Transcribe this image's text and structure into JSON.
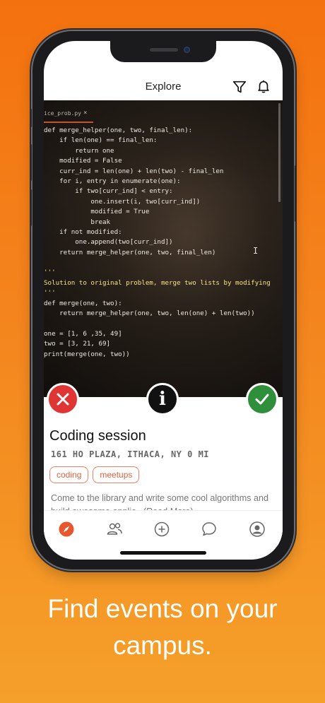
{
  "header": {
    "title": "Explore"
  },
  "editor": {
    "tab_name": "ice_prob.py",
    "tab_close": "×",
    "cursor_glyph": "I",
    "lines": [
      "def merge_helper(one, two, final_len):",
      "    if len(one) == final_len:",
      "        return one",
      "    modified = False",
      "    curr_ind = len(one) + len(two) - final_len",
      "    for i, entry in enumerate(one):",
      "        if two[curr_ind] < entry:",
      "            one.insert(i, two[curr_ind])",
      "            modified = True",
      "            break",
      "    if not modified:",
      "        one.append(two[curr_ind])",
      "    return merge_helper(one, two, final_len)",
      "",
      "'''",
      "Solution to original problem, merge two lists by modifying",
      "'''",
      "def merge(one, two):",
      "    return merge_helper(one, two, len(one) + len(two))",
      "",
      "one = [1, 6 ,35, 49]",
      "two = [3, 21, 69]",
      "print(merge(one, two))"
    ]
  },
  "actions": {
    "reject_icon": "x-icon",
    "info_label": "i",
    "accept_icon": "check-icon"
  },
  "event": {
    "title": "Coding session",
    "location": "161 HO PLAZA, ITHACA, NY   0 MI",
    "tags": [
      "coding",
      "meetups"
    ],
    "description": "Come to the library and write some cool algorithms and build awesome applic...(Read More)"
  },
  "nav": {
    "active": "explore",
    "items": [
      "explore",
      "friends",
      "add",
      "chat",
      "profile"
    ]
  },
  "caption": {
    "line1": "Find events on your",
    "line2": "campus."
  },
  "colors": {
    "accent": "#e9552d",
    "reject": "#e03535",
    "accept": "#2f8f3a"
  }
}
